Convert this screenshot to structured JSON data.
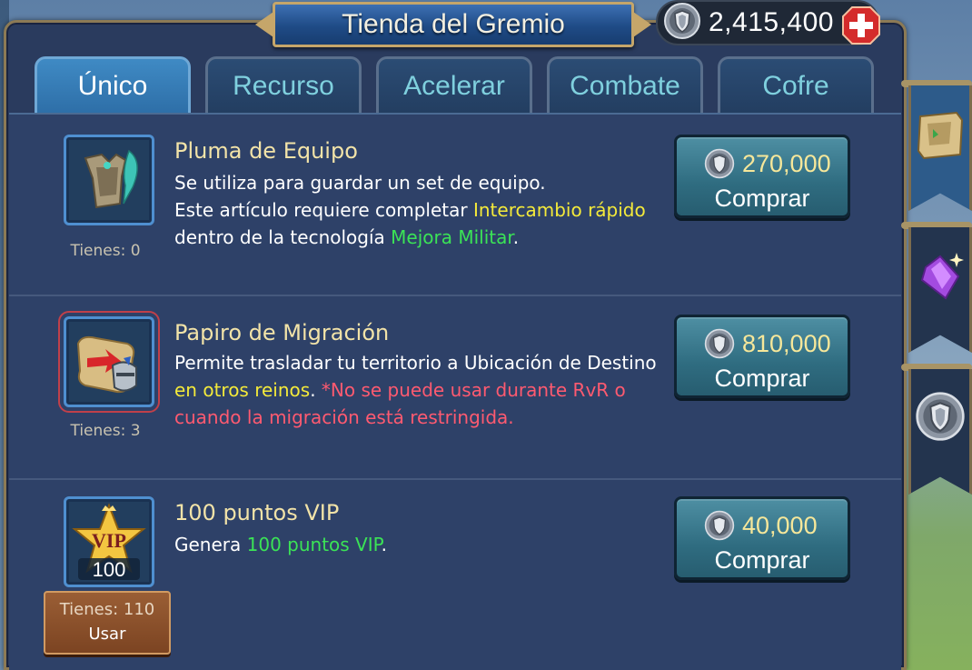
{
  "header": {
    "title": "Tienda del Gremio",
    "currency_value": "2,415,400"
  },
  "tabs": [
    {
      "label": "Único",
      "active": true
    },
    {
      "label": "Recurso",
      "active": false
    },
    {
      "label": "Acelerar",
      "active": false
    },
    {
      "label": "Combate",
      "active": false
    },
    {
      "label": "Cofre",
      "active": false
    }
  ],
  "items": [
    {
      "name": "Pluma de Equipo",
      "owned": "Tienes: 0",
      "desc": {
        "line1": "Se utiliza para guardar un set de equipo.",
        "p1": "Este artículo requiere completar ",
        "hl1": "Intercambio rápido",
        "p2": " dentro de la tecnología ",
        "hl2": "Mejora Militar",
        "p3": "."
      },
      "price": "270,000",
      "buy_label": "Comprar",
      "icon": "armor-feather-icon"
    },
    {
      "name": "Papiro de Migración",
      "owned": "Tienes: 3",
      "desc": {
        "p1": "Permite trasladar tu territorio a Ubicación de Destino ",
        "hl1": "en otros reinos",
        "p2": ". ",
        "warn": "*No se puede usar durante RvR o cuando la migración está restringida."
      },
      "price": "810,000",
      "buy_label": "Comprar",
      "icon": "migration-scroll-icon"
    },
    {
      "name": "100 puntos VIP",
      "owned": "Tienes: 110",
      "use_label": "Usar",
      "badge_text": "VIP",
      "badge_number": "100",
      "desc": {
        "p1": "Genera ",
        "hl1": "100 puntos VIP",
        "p2": "."
      },
      "price": "40,000",
      "buy_label": "Comprar",
      "icon": "vip-star-icon"
    }
  ],
  "side_tabs": [
    {
      "icon": "scroll-pack-icon",
      "active": true
    },
    {
      "icon": "purple-gem-icon",
      "active": false
    },
    {
      "icon": "guild-coin-icon",
      "active": false
    }
  ],
  "colors": {
    "panel": "#2a3b5e",
    "highlight_yellow": "#f4ea3a",
    "highlight_green": "#3be356",
    "warning_red": "#ff5a70",
    "item_name": "#f2e3a8"
  }
}
